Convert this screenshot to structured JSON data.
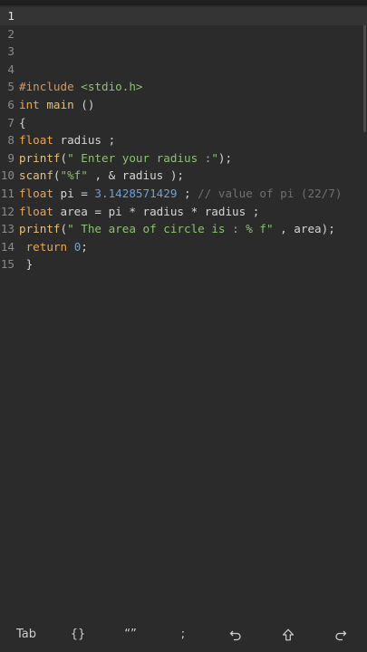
{
  "editor": {
    "current_line": "1",
    "lines": [
      {
        "num": "1",
        "segments": []
      },
      {
        "num": "2",
        "segments": []
      },
      {
        "num": "3",
        "segments": []
      },
      {
        "num": "4",
        "segments": []
      },
      {
        "num": "5",
        "segments": [
          {
            "t": "pp",
            "v": "#include"
          },
          {
            "t": "ws",
            "v": " "
          },
          {
            "t": "str",
            "v": "<stdio.h>"
          }
        ]
      },
      {
        "num": "6",
        "segments": [
          {
            "t": "kw",
            "v": "int"
          },
          {
            "t": "ws",
            "v": " "
          },
          {
            "t": "fn",
            "v": "main"
          },
          {
            "t": "op",
            "v": " ()"
          }
        ]
      },
      {
        "num": "7",
        "segments": [
          {
            "t": "op",
            "v": "{"
          }
        ]
      },
      {
        "num": "8",
        "segments": [
          {
            "t": "kw",
            "v": "float"
          },
          {
            "t": "op",
            "v": " radius ;"
          }
        ]
      },
      {
        "num": "9",
        "segments": [
          {
            "t": "fn",
            "v": "printf"
          },
          {
            "t": "op",
            "v": "("
          },
          {
            "t": "str",
            "v": "\" Enter your radius :\""
          },
          {
            "t": "op",
            "v": ");"
          }
        ]
      },
      {
        "num": "10",
        "segments": [
          {
            "t": "fn",
            "v": "scanf"
          },
          {
            "t": "op",
            "v": "("
          },
          {
            "t": "str",
            "v": "\"%f\""
          },
          {
            "t": "op",
            "v": " , & radius );"
          }
        ]
      },
      {
        "num": "11",
        "segments": [
          {
            "t": "kw",
            "v": "float"
          },
          {
            "t": "op",
            "v": " pi = "
          },
          {
            "t": "num",
            "v": "3.1428571429"
          },
          {
            "t": "op",
            "v": " ; "
          },
          {
            "t": "cmt",
            "v": "// value of pi (22/7)"
          }
        ]
      },
      {
        "num": "12",
        "segments": [
          {
            "t": "kw",
            "v": "float"
          },
          {
            "t": "op",
            "v": " area = pi * radius * radius ;"
          }
        ]
      },
      {
        "num": "13",
        "segments": [
          {
            "t": "fn",
            "v": "printf"
          },
          {
            "t": "op",
            "v": "("
          },
          {
            "t": "str",
            "v": "\" The area of circle is : % f\""
          },
          {
            "t": "op",
            "v": " , area);"
          }
        ]
      },
      {
        "num": "14",
        "segments": [
          {
            "t": "ws",
            "v": " "
          },
          {
            "t": "kw",
            "v": "return"
          },
          {
            "t": "ws",
            "v": " "
          },
          {
            "t": "num",
            "v": "0"
          },
          {
            "t": "op",
            "v": ";"
          }
        ]
      },
      {
        "num": "15",
        "segments": [
          {
            "t": "op",
            "v": " }"
          }
        ]
      }
    ]
  },
  "toolbar": {
    "tab_label": "Tab",
    "braces_label": "{}",
    "quotes_label": "“”",
    "semicolon_label": ";",
    "undo_icon": "undo-icon",
    "shift_icon": "shift-arrow-icon",
    "redo_icon": "redo-icon"
  },
  "colors": {
    "background": "#2b2b2b",
    "keyword": "#e8a54f",
    "function": "#e6c07b",
    "string": "#8fbf74",
    "number": "#6aa0d8",
    "comment": "#6f6f6f"
  }
}
